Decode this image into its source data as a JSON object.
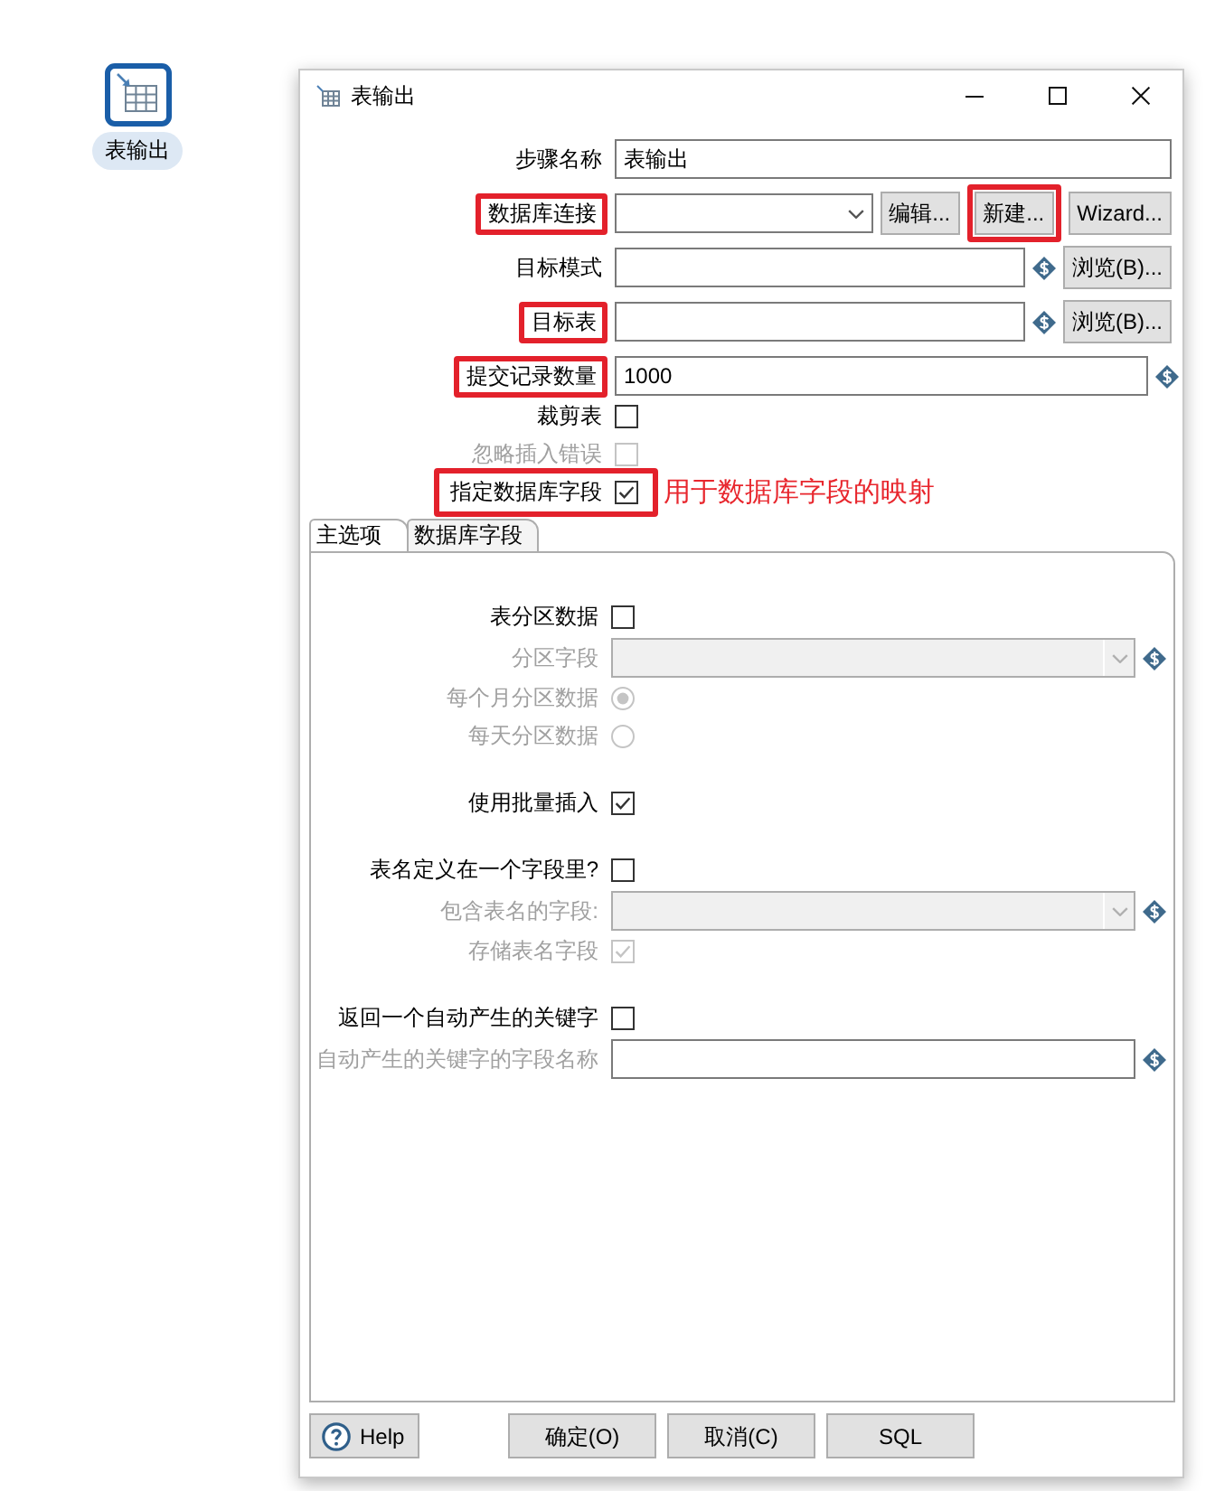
{
  "canvas_step": {
    "label": "表输出"
  },
  "window": {
    "title": "表输出"
  },
  "form": {
    "rows": [
      {
        "kind": "text",
        "label": "步骤名称",
        "value": "表输出",
        "variables": false,
        "disabled": false,
        "highlighted": false
      },
      {
        "kind": "select",
        "label": "数据库连接",
        "variables": false,
        "disabled": false,
        "highlighted": true,
        "buttons": [
          {
            "label": "编辑...",
            "highlighted": false
          },
          {
            "label": "新建...",
            "highlighted": true
          },
          {
            "label": "Wizard...",
            "highlighted": false
          }
        ]
      },
      {
        "kind": "text",
        "label": "目标模式",
        "variables": true,
        "disabled": false,
        "highlighted": false,
        "buttons": [
          {
            "label": "浏览(B)...",
            "highlighted": false
          }
        ]
      },
      {
        "kind": "text",
        "label": "目标表",
        "variables": true,
        "disabled": false,
        "highlighted": true,
        "buttons": [
          {
            "label": "浏览(B)...",
            "highlighted": false
          }
        ]
      },
      {
        "kind": "text",
        "label": "提交记录数量",
        "value": "1000",
        "variables": true,
        "disabled": false,
        "highlighted": true
      },
      {
        "kind": "checkbox",
        "label": "裁剪表",
        "checked": false,
        "disabled": false,
        "highlighted": false
      },
      {
        "kind": "checkbox",
        "label": "忽略插入错误",
        "checked": false,
        "disabled": true,
        "highlighted": false
      },
      {
        "kind": "checkbox",
        "label": "指定数据库字段",
        "checked": true,
        "disabled": false,
        "highlighted": true,
        "note": "用于数据库字段的映射"
      }
    ]
  },
  "tabs": [
    {
      "label": "主选项",
      "selected": true
    },
    {
      "label": "数据库字段",
      "selected": false
    }
  ],
  "panel": {
    "sections": [
      {
        "rows": [
          {
            "kind": "checkbox",
            "label": "表分区数据",
            "checked": false,
            "disabled": false
          },
          {
            "kind": "select",
            "label": "分区字段",
            "variables": true,
            "disabled": true
          },
          {
            "kind": "radio",
            "label": "每个月分区数据",
            "selected": true,
            "disabled": true
          },
          {
            "kind": "radio",
            "label": "每天分区数据",
            "selected": false,
            "disabled": true
          }
        ]
      },
      {
        "rows": [
          {
            "kind": "checkbox",
            "label": "使用批量插入",
            "checked": true,
            "disabled": false
          }
        ]
      },
      {
        "rows": [
          {
            "kind": "checkbox",
            "label": "表名定义在一个字段里?",
            "checked": false,
            "disabled": false
          },
          {
            "kind": "select",
            "label": "包含表名的字段:",
            "variables": true,
            "disabled": true
          },
          {
            "kind": "checkbox",
            "label": "存储表名字段",
            "checked": true,
            "disabled": true
          }
        ]
      },
      {
        "rows": [
          {
            "kind": "checkbox",
            "label": "返回一个自动产生的关键字",
            "checked": false,
            "disabled": false
          },
          {
            "kind": "text",
            "label": "自动产生的关键字的字段名称",
            "variables": true,
            "disabled": true
          }
        ]
      }
    ]
  },
  "footer_buttons": [
    {
      "kind": "help",
      "label": "Help"
    },
    {
      "kind": "plain",
      "label": "确定(O)"
    },
    {
      "kind": "plain",
      "label": "取消(C)"
    },
    {
      "kind": "plain",
      "label": "SQL"
    }
  ]
}
